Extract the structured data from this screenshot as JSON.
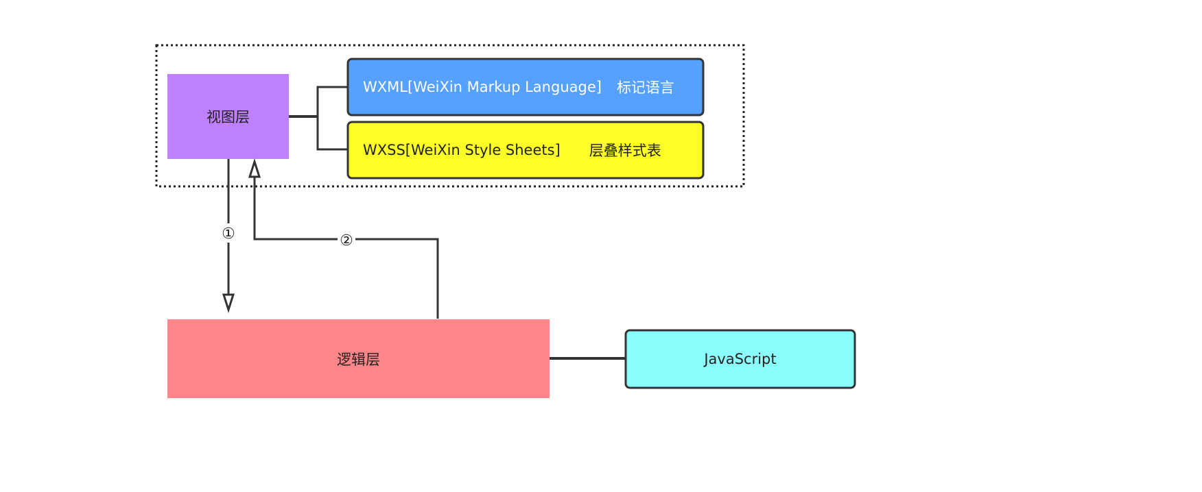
{
  "nodes": {
    "view_layer": {
      "label": "视图层",
      "color": "#bf80fc"
    },
    "wxml": {
      "label": "WXML[WeiXin Markup Language]",
      "desc": "标记语言",
      "color": "#55a1fd"
    },
    "wxss": {
      "label": "WXSS[WeiXin Style Sheets]",
      "desc": "层叠样式表",
      "color": "#fefe27"
    },
    "logic_layer": {
      "label": "逻辑层",
      "color": "#fe8689"
    },
    "javascript": {
      "label": "JavaScript",
      "color": "#8bfefe"
    }
  },
  "edges": {
    "step1": {
      "label": "①"
    },
    "step2": {
      "label": "②"
    }
  }
}
